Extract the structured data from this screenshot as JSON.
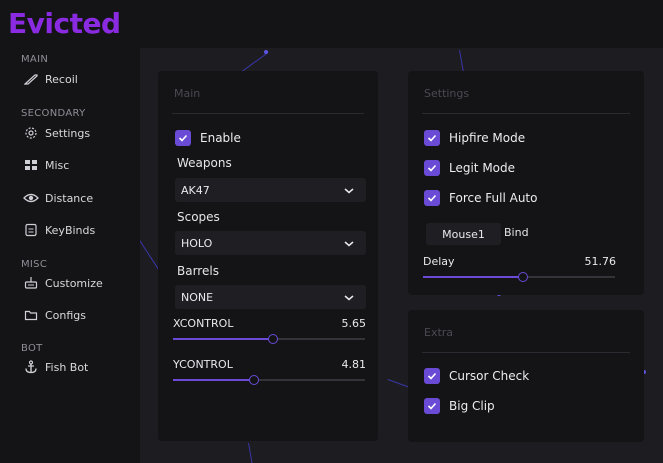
{
  "app": {
    "logo_text": "Evicted",
    "brand_color": "#8a2be2",
    "accent_color": "#6a4bd6"
  },
  "sidebar": {
    "sections": [
      {
        "title": "MAIN",
        "items": [
          {
            "label": "Recoil",
            "icon": "rifle-icon"
          }
        ]
      },
      {
        "title": "SECONDARY",
        "items": [
          {
            "label": "Settings",
            "icon": "gear-icon"
          },
          {
            "label": "Misc",
            "icon": "grid-icon"
          },
          {
            "label": "Distance",
            "icon": "eye-icon"
          },
          {
            "label": "KeyBinds",
            "icon": "keyboard-icon"
          }
        ]
      },
      {
        "title": "MISC",
        "items": [
          {
            "label": "Customize",
            "icon": "customize-icon"
          },
          {
            "label": "Configs",
            "icon": "folder-icon"
          }
        ]
      },
      {
        "title": "BOT",
        "items": [
          {
            "label": "Fish Bot",
            "icon": "anchor-icon"
          }
        ]
      }
    ]
  },
  "main_panel": {
    "title": "Main",
    "enable": {
      "label": "Enable",
      "checked": true
    },
    "weapons": {
      "label": "Weapons",
      "value": "AK47"
    },
    "scopes": {
      "label": "Scopes",
      "value": "HOLO"
    },
    "barrels": {
      "label": "Barrels",
      "value": "NONE"
    },
    "xcontrol": {
      "label": "XCONTROL",
      "value": "5.65",
      "fraction": 0.52
    },
    "ycontrol": {
      "label": "YCONTROL",
      "value": "4.81",
      "fraction": 0.42
    }
  },
  "settings_panel": {
    "title": "Settings",
    "hipfire": {
      "label": "Hipfire Mode",
      "checked": true
    },
    "legit": {
      "label": "Legit Mode",
      "checked": true
    },
    "force_auto": {
      "label": "Force Full Auto",
      "checked": true
    },
    "bind_button": "Mouse1",
    "bind_label": "Bind",
    "delay": {
      "label": "Delay",
      "value": "51.76",
      "fraction": 0.52
    }
  },
  "extra_panel": {
    "title": "Extra",
    "cursor_check": {
      "label": "Cursor Check",
      "checked": true
    },
    "big_clip": {
      "label": "Big Clip",
      "checked": true
    }
  }
}
